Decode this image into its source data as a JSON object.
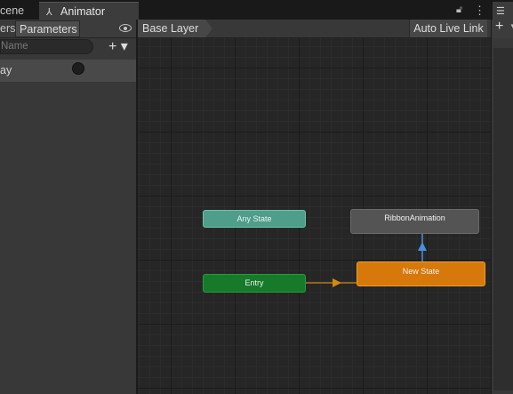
{
  "window": {
    "tabs": [
      {
        "label": "cene",
        "active": false
      },
      {
        "label": "Animator",
        "active": true
      }
    ]
  },
  "left_panel": {
    "tabs": [
      {
        "label": "ers",
        "active": false
      },
      {
        "label": "Parameters",
        "active": true
      }
    ],
    "search_placeholder": "Name",
    "add_label": "+ ▾",
    "parameters": [
      {
        "name": "ay",
        "type": "bool",
        "value": false
      }
    ]
  },
  "graph": {
    "breadcrumb": "Base Layer",
    "auto_live_link": "Auto Live Link",
    "nodes": [
      {
        "id": "any-state",
        "label": "Any State",
        "color": "#4f9e8a"
      },
      {
        "id": "ribbon",
        "label": "RibbonAnimation",
        "color": "#545454"
      },
      {
        "id": "entry",
        "label": "Entry",
        "color": "#167a2a"
      },
      {
        "id": "new-state",
        "label": "New State",
        "color": "#d6780a",
        "is_default": true
      }
    ],
    "transitions": [
      {
        "from": "Entry",
        "to": "New State",
        "color": "#d08a10"
      },
      {
        "from": "New State",
        "to": "RibbonAnimation",
        "color": "#4a8fdc"
      }
    ]
  },
  "right_panel": {
    "add_label": "+"
  },
  "icons": {
    "animator": "animator-graph-icon",
    "lock": "lock-icon",
    "menu": "kebab-menu-icon",
    "visibility": "eye-icon",
    "list": "list-icon"
  }
}
